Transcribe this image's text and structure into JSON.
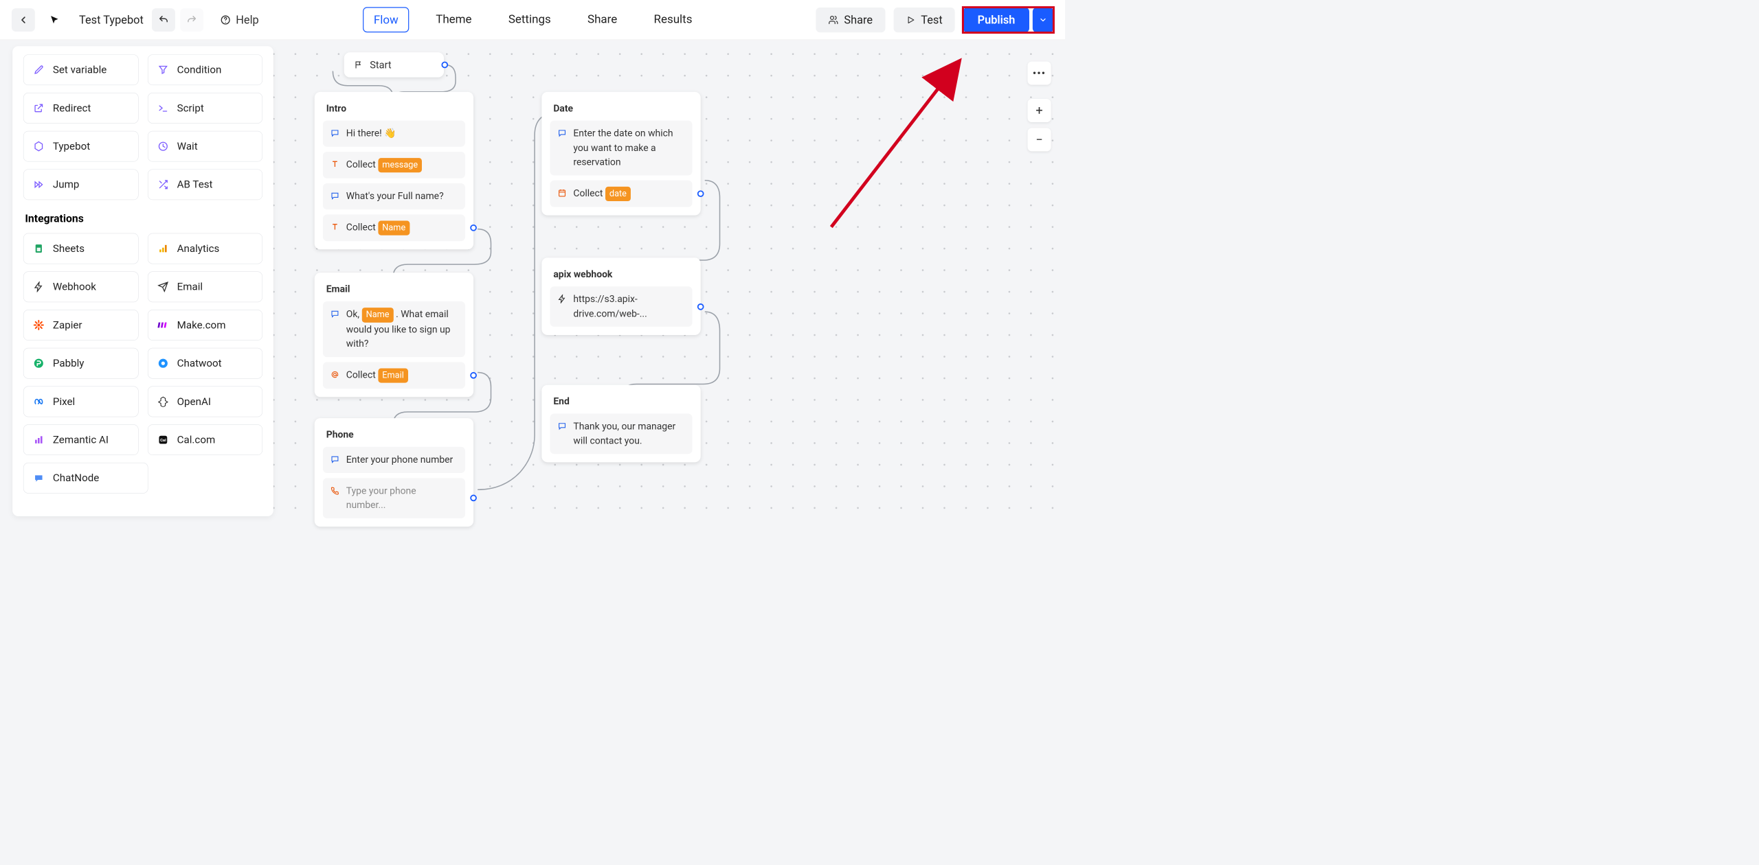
{
  "header": {
    "bot_name": "Test Typebot",
    "help": "Help",
    "nav": {
      "flow": "Flow",
      "theme": "Theme",
      "settings": "Settings",
      "share": "Share",
      "results": "Results"
    },
    "share_btn": "Share",
    "test_btn": "Test",
    "publish_btn": "Publish"
  },
  "sidebar": {
    "logic": {
      "set_variable": "Set variable",
      "condition": "Condition",
      "redirect": "Redirect",
      "script": "Script",
      "typebot": "Typebot",
      "wait": "Wait",
      "jump": "Jump",
      "ab_test": "AB Test"
    },
    "integrations_title": "Integrations",
    "integrations": {
      "sheets": "Sheets",
      "analytics": "Analytics",
      "webhook": "Webhook",
      "email": "Email",
      "zapier": "Zapier",
      "make": "Make.com",
      "pabbly": "Pabbly",
      "chatwoot": "Chatwoot",
      "pixel": "Pixel",
      "openai": "OpenAI",
      "zemantic": "Zemantic AI",
      "calcom": "Cal.com",
      "chatnode": "ChatNode"
    }
  },
  "flow": {
    "start": "Start",
    "intro": {
      "title": "Intro",
      "n1": "Hi there!  👋",
      "n2a": "Collect ",
      "n2b": "message",
      "n3": "What's your Full name?",
      "n4a": "Collect ",
      "n4b": "Name"
    },
    "email": {
      "title": "Email",
      "n1a": "Ok, ",
      "n1b": "Name",
      "n1c": " . What email would you like to sign up with?",
      "n2a": "Collect ",
      "n2b": "Email"
    },
    "phone": {
      "title": "Phone",
      "n1": "Enter your phone number",
      "n2": "Type your phone number..."
    },
    "date": {
      "title": "Date",
      "n1": "Enter the date on which you want to make a reservation",
      "n2a": "Collect ",
      "n2b": "date"
    },
    "hook": {
      "title": "apix webhook",
      "n1": "https://s3.apix-drive.com/web-..."
    },
    "end": {
      "title": "End",
      "n1": "Thank you, our manager will contact you."
    }
  }
}
